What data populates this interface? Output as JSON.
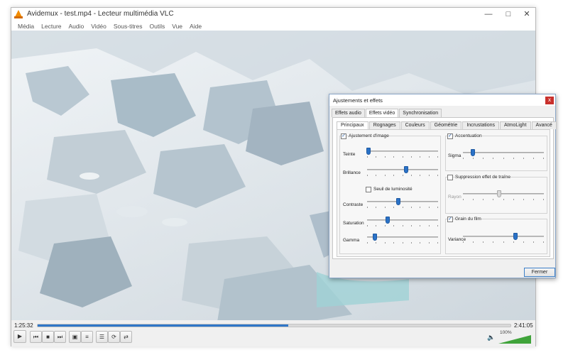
{
  "window": {
    "title": "Avidemux - test.mp4 - Lecteur multimédia VLC"
  },
  "menu": [
    "Média",
    "Lecture",
    "Audio",
    "Vidéo",
    "Sous-titres",
    "Outils",
    "Vue",
    "Aide"
  ],
  "playback": {
    "elapsed": "1:25:32",
    "total": "2:41:05",
    "progress": 0.53,
    "volume_label": "100%",
    "volume": 1.0
  },
  "dialog": {
    "title": "Ajustements et effets",
    "close_glyph": "x",
    "tabs": [
      "Effets audio",
      "Effets vidéo",
      "Synchronisation"
    ],
    "active_tab": 1,
    "subtabs": [
      "Principaux",
      "Rognages",
      "Couleurs",
      "Géométrie",
      "Incrustations",
      "AtmoLight",
      "Avancé"
    ],
    "active_subtab": 0,
    "image_adjust": {
      "label": "Ajustement d'image",
      "checked": true,
      "teinte": {
        "label": "Teinte",
        "value": 0.02
      },
      "brillance": {
        "label": "Brillance",
        "value": 0.55
      },
      "seuil": {
        "label": "Seuil de luminosité",
        "checked": false
      },
      "contraste": {
        "label": "Contraste",
        "value": 0.44
      },
      "saturation": {
        "label": "Saturation",
        "value": 0.29
      },
      "gamma": {
        "label": "Gamma",
        "value": 0.11
      }
    },
    "sharpen": {
      "label": "Accentuation",
      "checked": true,
      "sigma": {
        "label": "Sigma",
        "value": 0.12
      }
    },
    "ghost": {
      "label": "Suppression effet de traîne",
      "checked": false,
      "rayon": {
        "label": "Rayon",
        "value": 0.45
      }
    },
    "grain": {
      "label": "Grain du film",
      "checked": true,
      "variance": {
        "label": "Variance",
        "value": 0.65
      }
    },
    "close_button": "Fermer"
  }
}
